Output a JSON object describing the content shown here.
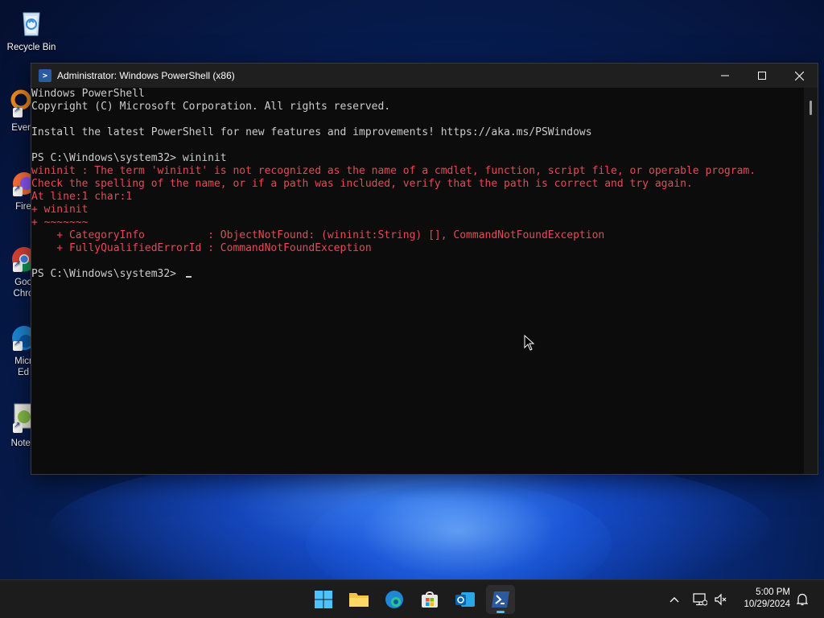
{
  "desktop": {
    "icons": [
      {
        "label": "Recycle Bin",
        "icon": "recycle-bin-icon"
      },
      {
        "label": "Every",
        "icon": "everything-search-icon"
      },
      {
        "label": "Fire",
        "icon": "firefox-icon"
      },
      {
        "label": "Goo\nChro",
        "icon": "chrome-icon"
      },
      {
        "label": "Micr\nEd",
        "icon": "edge-icon"
      },
      {
        "label": "Notep",
        "icon": "notepad-plus-plus-icon"
      }
    ]
  },
  "window": {
    "title": "Administrator: Windows PowerShell (x86)",
    "controls": {
      "minimize": "—",
      "maximize": "☐",
      "close": "✕"
    },
    "console_lines": [
      {
        "text": "Windows PowerShell",
        "color": "white"
      },
      {
        "text": "Copyright (C) Microsoft Corporation. All rights reserved.",
        "color": "white"
      },
      {
        "text": "",
        "color": "white"
      },
      {
        "text": "Install the latest PowerShell for new features and improvements! https://aka.ms/PSWindows",
        "color": "white"
      },
      {
        "text": "",
        "color": "white"
      },
      {
        "text": "PS C:\\Windows\\system32> wininit",
        "color": "white"
      },
      {
        "text": "wininit : The term 'wininit' is not recognized as the name of a cmdlet, function, script file, or operable program.",
        "color": "red"
      },
      {
        "text": "Check the spelling of the name, or if a path was included, verify that the path is correct and try again.",
        "color": "red"
      },
      {
        "text": "At line:1 char:1",
        "color": "red"
      },
      {
        "text": "+ wininit",
        "color": "red"
      },
      {
        "text": "+ ~~~~~~~",
        "color": "red"
      },
      {
        "text": "    + CategoryInfo          : ObjectNotFound: (wininit:String) [], CommandNotFoundException",
        "color": "red"
      },
      {
        "text": "    + FullyQualifiedErrorId : CommandNotFoundException",
        "color": "red"
      },
      {
        "text": "",
        "color": "white"
      },
      {
        "text": "PS C:\\Windows\\system32> ",
        "color": "white",
        "cursor": true
      }
    ]
  },
  "taskbar": {
    "apps": [
      {
        "name": "start-button",
        "icon": "windows-logo-icon"
      },
      {
        "name": "file-explorer",
        "icon": "folder-icon"
      },
      {
        "name": "edge",
        "icon": "edge-icon"
      },
      {
        "name": "microsoft-store",
        "icon": "store-icon"
      },
      {
        "name": "outlook",
        "icon": "outlook-icon"
      },
      {
        "name": "powershell",
        "icon": "powershell-icon",
        "active": true
      }
    ],
    "tray": {
      "chevron": "^",
      "time": "5:00 PM",
      "date": "10/29/2024"
    }
  },
  "colors": {
    "console_bg": "#0c0c0c",
    "console_text": "#cccccc",
    "error_text": "#e74856",
    "titlebar": "#1f1f1f",
    "taskbar": "#1c1c1c",
    "accent": "#4cc2ff"
  }
}
